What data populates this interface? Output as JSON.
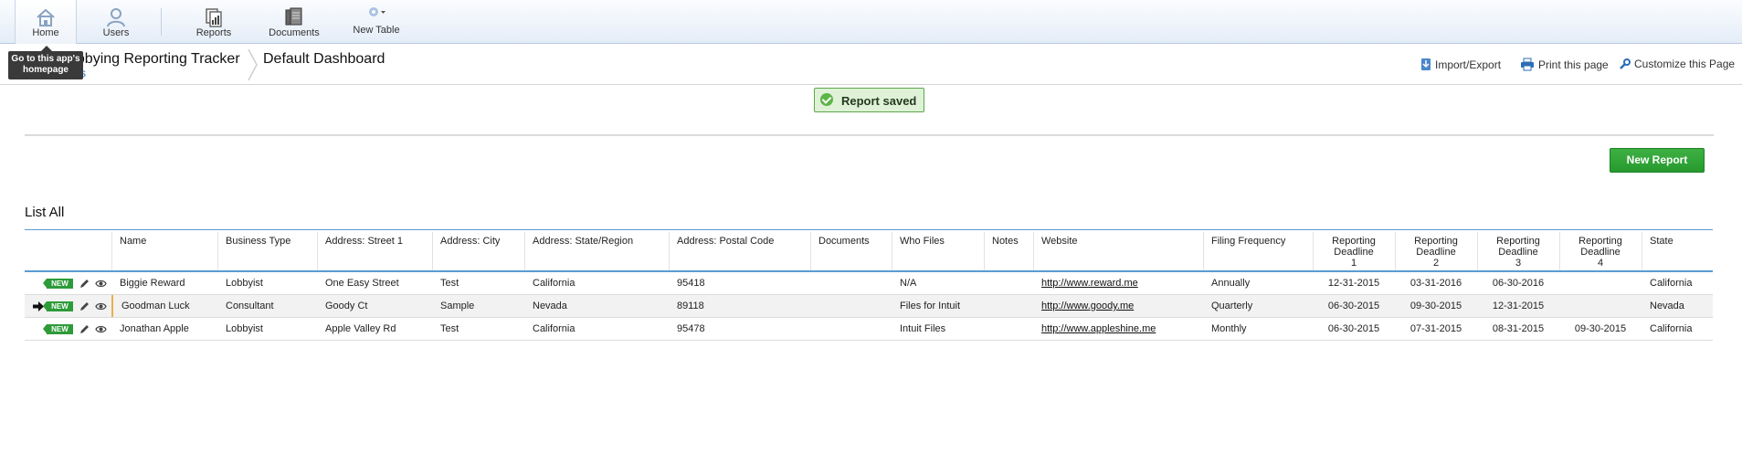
{
  "toolbar": {
    "home": "Home",
    "users": "Users",
    "reports": "Reports",
    "documents": "Documents",
    "new_table": "New Table"
  },
  "tooltip": "Go to this app's homepage",
  "header": {
    "app_title": "obbying Reporting Tracker",
    "dashboard_title": "Default Dashboard",
    "sub_link": "s"
  },
  "actions": {
    "import_export": "Import/Export",
    "print": "Print this page",
    "customize": "Customize this Page"
  },
  "status_message": "Report saved",
  "new_report_button": "New Report",
  "list_title": "List All",
  "table": {
    "columns": [
      "Name",
      "Business Type",
      "Address: Street 1",
      "Address: City",
      "Address: State/Region",
      "Address: Postal Code",
      "Documents",
      "Who Files",
      "Notes",
      "Website",
      "Filing Frequency",
      "Reporting Deadline 1",
      "Reporting Deadline 2",
      "Reporting Deadline 3",
      "Reporting Deadline 4",
      "State"
    ],
    "deadline_header": "Reporting\nDeadline",
    "new_badge": "NEW",
    "rows": [
      [
        "Biggie Reward",
        "Lobbyist",
        "One Easy Street",
        "Test",
        "California",
        "95418",
        "",
        "N/A",
        "",
        "http://www.reward.me",
        "Annually",
        "12-31-2015",
        "03-31-2016",
        "06-30-2016",
        "",
        "California"
      ],
      [
        "Goodman Luck",
        "Consultant",
        "Goody Ct",
        "Sample",
        "Nevada",
        "89118",
        "",
        "Files for Intuit",
        "",
        "http://www.goody.me",
        "Quarterly",
        "06-30-2015",
        "09-30-2015",
        "12-31-2015",
        "",
        "Nevada"
      ],
      [
        "Jonathan Apple",
        "Lobbyist",
        "Apple Valley Rd",
        "Test",
        "California",
        "95478",
        "",
        "Intuit Files",
        "",
        "http://www.appleshine.me",
        "Monthly",
        "06-30-2015",
        "07-31-2015",
        "08-31-2015",
        "09-30-2015",
        "California"
      ]
    ]
  },
  "colors": {
    "accent_blue": "#5b9bd5",
    "success_green": "#2e9b39",
    "toolbar_bg": "#e4edf8"
  }
}
